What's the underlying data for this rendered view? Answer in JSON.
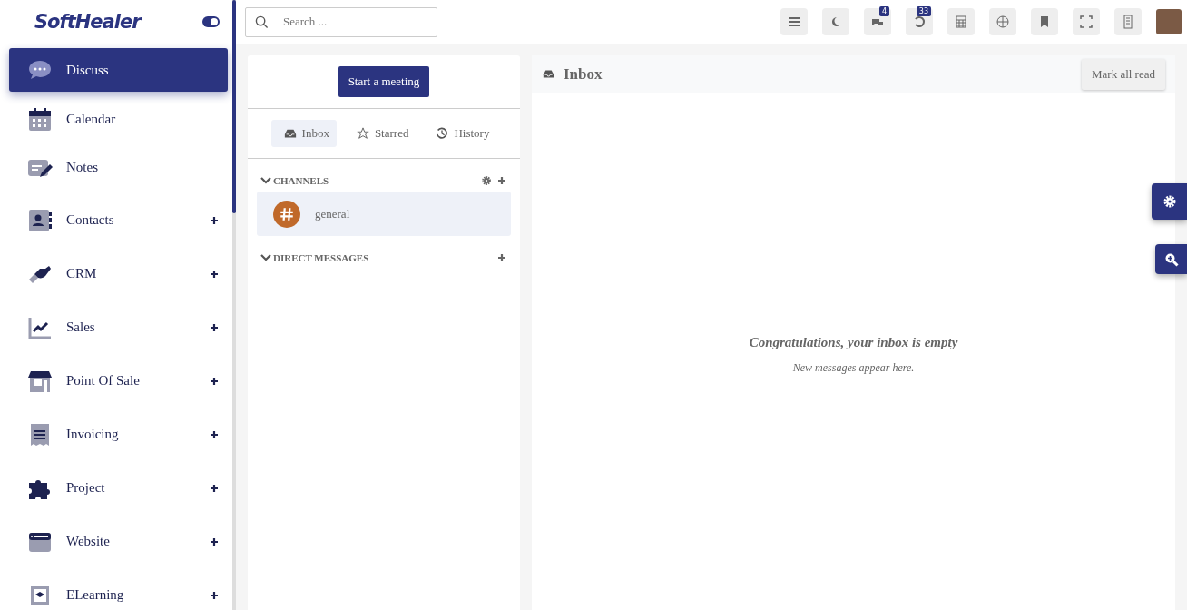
{
  "brand": {
    "logo": "SoftHealer",
    "theme_toggle_on": true
  },
  "sidebar": {
    "items": [
      {
        "label": "Discuss",
        "selected": true,
        "expandable": false
      },
      {
        "label": "Calendar",
        "selected": false,
        "expandable": false
      },
      {
        "label": "Notes",
        "selected": false,
        "expandable": false
      },
      {
        "label": "Contacts",
        "selected": false,
        "expandable": true
      },
      {
        "label": "CRM",
        "selected": false,
        "expandable": true
      },
      {
        "label": "Sales",
        "selected": false,
        "expandable": true
      },
      {
        "label": "Point Of Sale",
        "selected": false,
        "expandable": true
      },
      {
        "label": "Invoicing",
        "selected": false,
        "expandable": true
      },
      {
        "label": "Project",
        "selected": false,
        "expandable": true
      },
      {
        "label": "Website",
        "selected": false,
        "expandable": true
      },
      {
        "label": "ELearning",
        "selected": false,
        "expandable": true
      }
    ]
  },
  "search": {
    "placeholder": "Search ..."
  },
  "toolbar": {
    "messages_badge": "4",
    "activities_badge": "33"
  },
  "discuss": {
    "start_button": "Start a meeting",
    "tabs": [
      {
        "label": "Inbox",
        "selected": true
      },
      {
        "label": "Starred",
        "selected": false
      },
      {
        "label": "History",
        "selected": false
      }
    ],
    "channels": {
      "title": "CHANNELS",
      "items": [
        {
          "name": "general",
          "selected": true,
          "color": "#c0692a"
        }
      ]
    },
    "direct_messages": {
      "title": "DIRECT MESSAGES"
    }
  },
  "inbox": {
    "title": "Inbox",
    "mark_all_read": "Mark all read",
    "empty_title": "Congratulations, your inbox is empty",
    "empty_text": "New messages appear here."
  }
}
